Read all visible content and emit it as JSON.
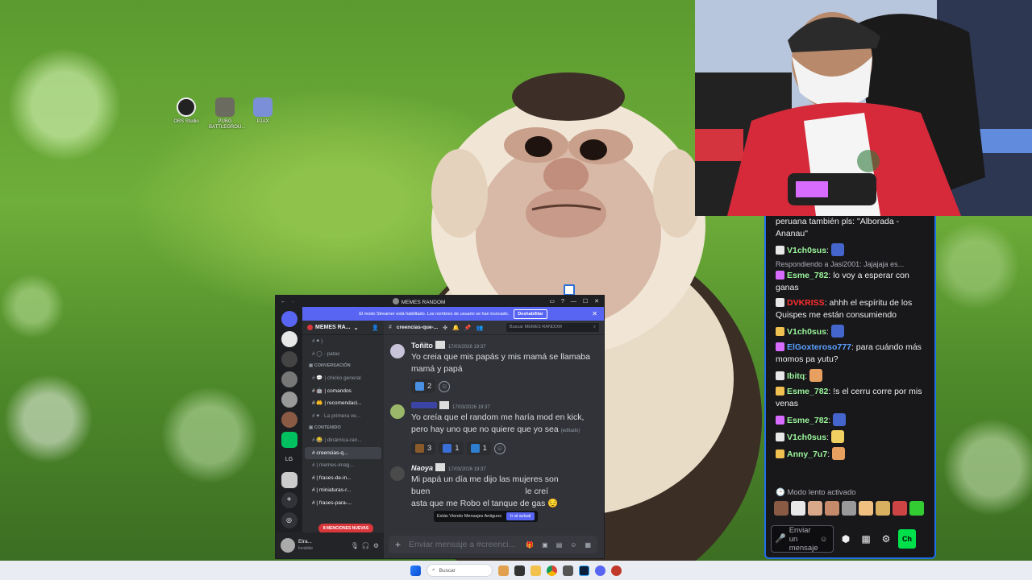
{
  "desktop": {
    "icons": [
      {
        "label": "OBS Studio",
        "color": "#222222"
      },
      {
        "label": "PUBG BATTLEGROU...",
        "color": "#6b6b60"
      },
      {
        "label": "PJAX",
        "color": "#7a8fd8"
      }
    ]
  },
  "discord": {
    "window_title": "MEMES RANDOM",
    "banner_text": "El modo Streamer está habilitado. Los nombres de usuario se han truncado.",
    "banner_button": "Deshabilitar",
    "server_name": "MEMES RA...",
    "channel_header": "creencias-que-...",
    "search_placeholder": "Buscar MEMES RANDOM",
    "channels": [
      {
        "label": "♥ )",
        "kind": "ch"
      },
      {
        "label": "◯ · patas",
        "kind": "ch"
      },
      {
        "label": "▣ CONVERSACIÓN",
        "kind": "cat"
      },
      {
        "label": "💬 | chicko general",
        "kind": "ch"
      },
      {
        "label": "🤖 | comandos",
        "kind": "bright"
      },
      {
        "label": "🤲 | recomendaci...",
        "kind": "bright"
      },
      {
        "label": "♥ · La primera ve...",
        "kind": "ch"
      },
      {
        "label": "▣ CONTENIDO",
        "kind": "cat"
      },
      {
        "label": "😂 | dinámica-ran...",
        "kind": "ch"
      },
      {
        "label": "creencias-q...",
        "kind": "sel"
      },
      {
        "label": "| memes-imag...",
        "kind": "ch"
      },
      {
        "label": "| frases-de-in...",
        "kind": "bright"
      },
      {
        "label": "| miniaturas-r...",
        "kind": "bright"
      },
      {
        "label": "| frases-para-...",
        "kind": "bright"
      }
    ],
    "mentions_badge": "8 MENCIONES NUEVAS",
    "user": {
      "name": "Elra...",
      "status": "Invisible"
    },
    "messages": [
      {
        "author": "Toñito",
        "author_color": "#f2f3f5",
        "timestamp": "17/03/2026 19:37",
        "text": "Yo creia que mis papás y mis mamá se llamaba mamá y papá",
        "edited": "",
        "avatar_color": "#c8c3d8",
        "reactions": [
          {
            "emoji_color": "#4a90e2",
            "count": "2"
          }
        ]
      },
      {
        "author": "",
        "author_color": "#5865f2",
        "timestamp": "17/03/2026 19:37",
        "text": "Yo creía que el random me haría mod en kick, pero hay uno que no quiere que yo sea",
        "edited": "(editado)",
        "avatar_color": "#9bb86a",
        "reactions": [
          {
            "emoji_color": "#8b5a2b",
            "count": "3"
          },
          {
            "emoji_color": "#3b6fd8",
            "count": "1"
          },
          {
            "emoji_color": "#2f7fd0",
            "count": "1"
          }
        ]
      },
      {
        "author": "Naoya",
        "author_color": "#f2f3f5",
        "timestamp": "17/03/2026 19:37",
        "text_line1": "Mi papá un día me dijo las mujeres son",
        "text_line2a": "buen",
        "text_line2b": "le creí",
        "text_line3": "asta que me Robo el tanque de gas 😔",
        "avatar_color": "#4a4a4a"
      }
    ],
    "overlay_text": "Estás Viendo Mensajes Antiguos",
    "overlay_button": "Ir al actual",
    "input_placeholder": "Enviar mensaje a #creenci..."
  },
  "chat": {
    "messages": [
      {
        "name": "",
        "text": "peruana también pls: \"Alborada - Ananau\""
      },
      {
        "name": "V1ch0sus",
        "name_color": "#9af59a",
        "text": "",
        "emote": true
      },
      {
        "reply": "Respondiendo a Jasi2001: Jajajaja es..."
      },
      {
        "name": "Esme_782",
        "name_color": "#9af59a",
        "text": "lo voy a esperar con ganas"
      },
      {
        "name": "DVKRISS",
        "name_color": "#ff2e2e",
        "text": "ahhh el espíritu de los Quispes me están consumiendo"
      },
      {
        "name": "V1ch0sus",
        "name_color": "#9af59a",
        "text": "",
        "emote": true
      },
      {
        "name": "ElGoxteroso777",
        "name_color": "#5aa0ff",
        "text": "para cuándo más momos pa yutu?"
      },
      {
        "name": "Ibitq",
        "name_color": "#9af59a",
        "text": "",
        "emote": true
      },
      {
        "name": "Esme_782",
        "name_color": "#9af59a",
        "text": "!s el cerru corre por mis venas"
      },
      {
        "name": "Esme_782",
        "name_color": "#9af59a",
        "text": "",
        "emote": true
      },
      {
        "name": "V1ch0sus",
        "name_color": "#9af59a",
        "text": "",
        "emote": true
      },
      {
        "name": "Anny_7u7",
        "name_color": "#9af59a",
        "text": "",
        "emote": true
      }
    ],
    "slow_mode": "Modo lento activado",
    "input_placeholder": "Enviar un mensaje",
    "send_label": "Ch"
  },
  "taskbar": {
    "search_placeholder": "Buscar"
  }
}
